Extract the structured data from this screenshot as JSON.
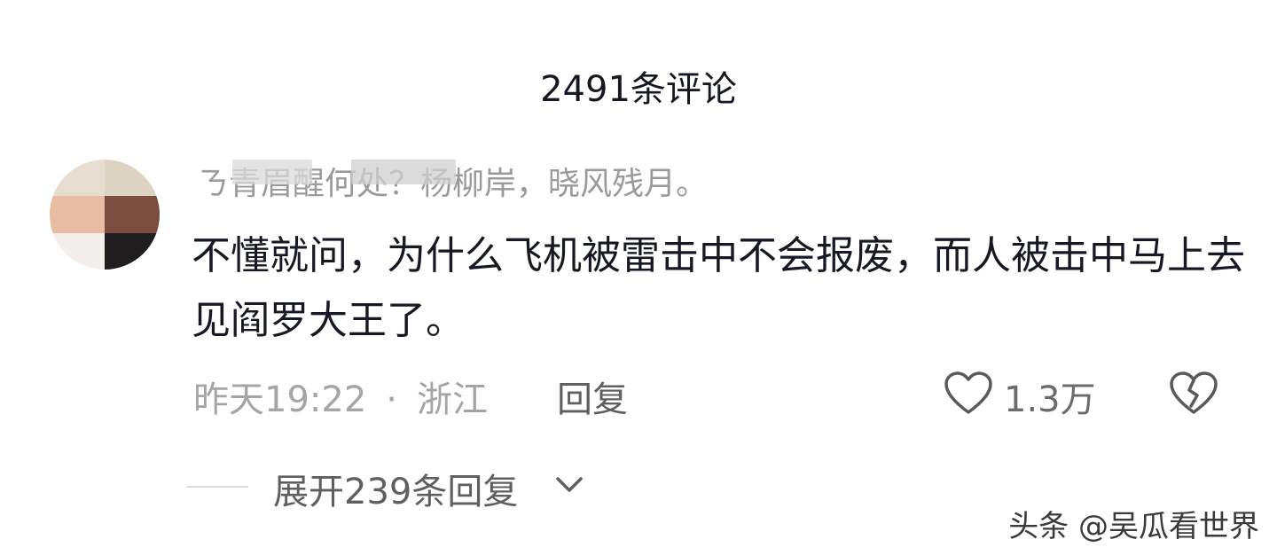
{
  "header": {
    "title": "2491条评论"
  },
  "comment": {
    "username": "ㄋ青眉醒何处？杨柳岸，晓风残月。",
    "text": "不懂就问，为什么飞机被雷击中不会报废，而人被击中马上去见阎罗大王了。",
    "time": "昨天19:22",
    "separator": "·",
    "location": "浙江",
    "reply_label": "回复",
    "like_count": "1.3万",
    "expand_label": "展开239条回复"
  },
  "watermark": "头条 @吴瓜看世界"
}
